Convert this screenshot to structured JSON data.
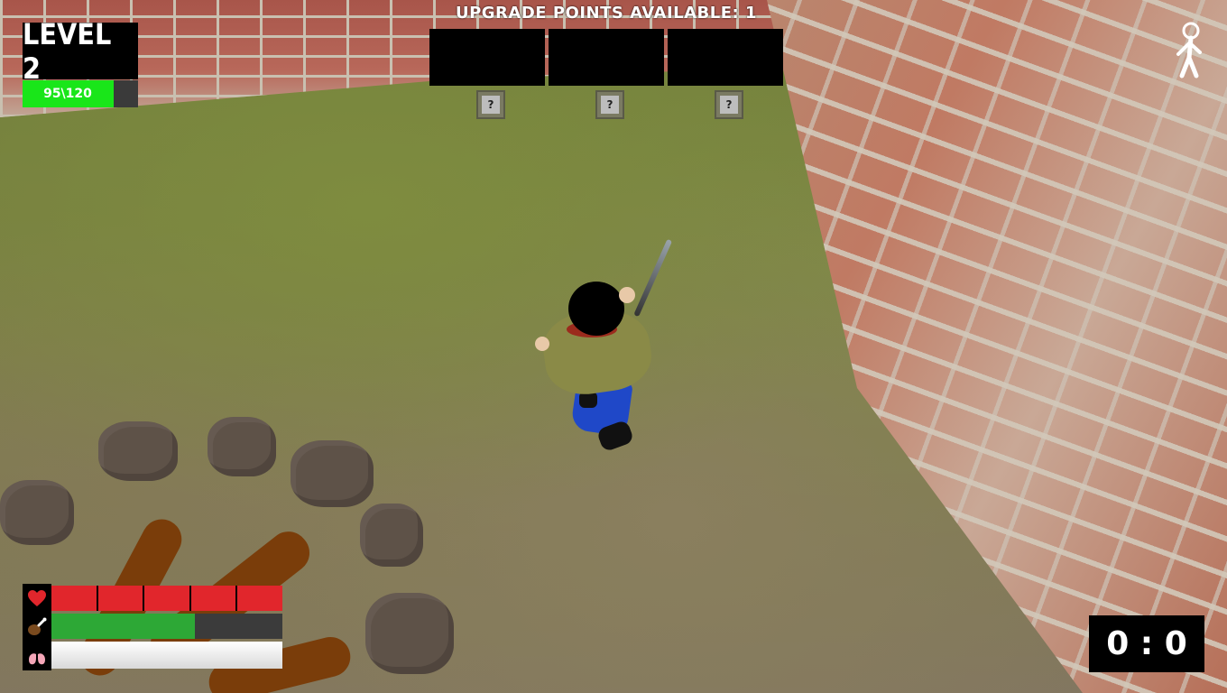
{
  "hud": {
    "level_label": "LEVEL 2",
    "xp_text": "95\\120",
    "xp_fraction": 0.79,
    "upgrade_title": "UPGRADE POINTS AVAILABLE: 1",
    "upgrade_slots": [
      "",
      "",
      ""
    ],
    "upgrade_hint_glyph": "?",
    "timer": "0 : 0",
    "health_segments_filled": 5,
    "health_segments_total": 5,
    "hunger_fraction": 0.62,
    "air_fraction": 1.0,
    "colors": {
      "health": "#e1262c",
      "hunger": "#2da836",
      "xp": "#19e619",
      "air": "#ffffff"
    },
    "icons": [
      "heart-icon",
      "drumstick-icon",
      "lungs-icon",
      "person-stance-icon"
    ]
  }
}
